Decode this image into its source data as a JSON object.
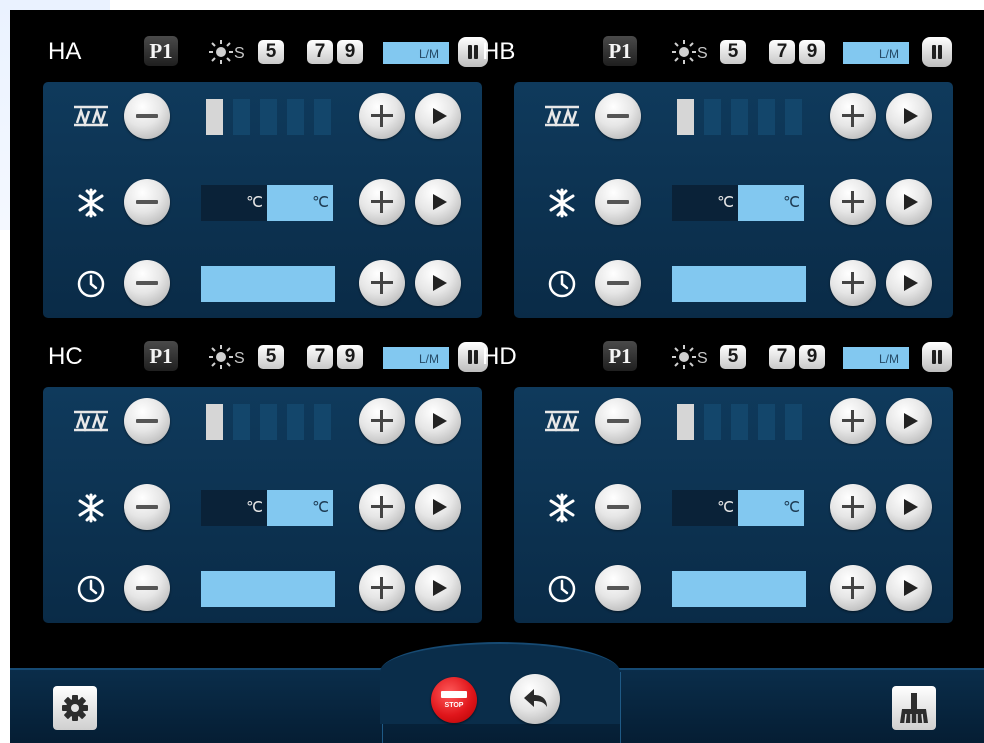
{
  "zones": [
    {
      "name": "HA",
      "program": "P1",
      "s_label": "S",
      "speeds": [
        "5",
        "7",
        "9"
      ],
      "lm_label": "L/M",
      "level_count": 1,
      "temp_unit_left": "℃",
      "temp_unit_right": "℃"
    },
    {
      "name": "HB",
      "program": "P1",
      "s_label": "S",
      "speeds": [
        "5",
        "7",
        "9"
      ],
      "lm_label": "L/M",
      "level_count": 1,
      "temp_unit_left": "℃",
      "temp_unit_right": "℃"
    },
    {
      "name": "HC",
      "program": "P1",
      "s_label": "S",
      "speeds": [
        "5",
        "7",
        "9"
      ],
      "lm_label": "L/M",
      "level_count": 1,
      "temp_unit_left": "℃",
      "temp_unit_right": "℃"
    },
    {
      "name": "HD",
      "program": "P1",
      "s_label": "S",
      "speeds": [
        "5",
        "7",
        "9"
      ],
      "lm_label": "L/M",
      "level_count": 1,
      "temp_unit_left": "℃",
      "temp_unit_right": "℃"
    }
  ],
  "level_segments_total": 5,
  "footer": {
    "stop_label": "STOP"
  },
  "colors": {
    "panel": "#0f3a5c",
    "accent_field": "#82c8f0",
    "stop_red": "#e0161b",
    "background": "#000000"
  },
  "icons": {
    "row1": "heater-grill-icon",
    "row2": "snowflake-icon",
    "row3": "clock-icon",
    "settings": "gear-icon",
    "back": "undo-arrow-icon",
    "clean": "brush-icon"
  }
}
